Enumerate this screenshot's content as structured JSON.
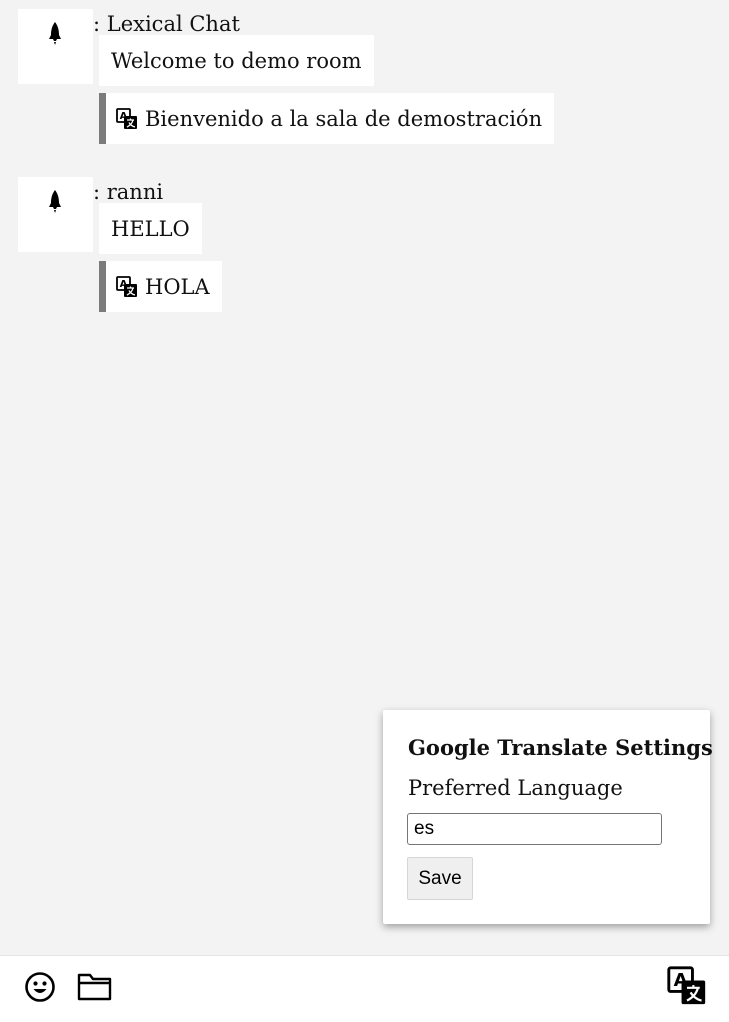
{
  "messages": [
    {
      "avatar_icon": "rocket-icon",
      "sender": ": Lexical Chat",
      "text": "Welcome to demo room",
      "translation": "Bienvenido a la sala de demostración",
      "translation_icon": "translate-icon"
    },
    {
      "avatar_icon": "rocket-icon",
      "sender": ": ranni",
      "text": "HELLO",
      "translation": "HOLA",
      "translation_icon": "translate-icon"
    }
  ],
  "settings": {
    "title": "Google Translate Settings",
    "language_label": "Preferred Language",
    "language_value": "es",
    "save_label": "Save"
  },
  "toolbar": {
    "emoji_icon": "emoji-icon",
    "folder_icon": "folder-icon",
    "translate_icon": "translate-icon"
  },
  "colors": {
    "background": "#f3f3f3",
    "bubble": "#ffffff",
    "translation_bar": "#7b7b7b"
  }
}
